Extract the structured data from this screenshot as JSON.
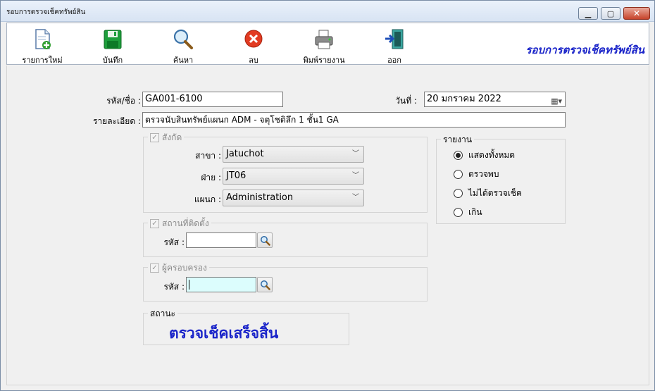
{
  "window": {
    "title": "รอบการตรวจเช็คทรัพย์สิน"
  },
  "toolbar": {
    "buttons": [
      {
        "label": "รายการใหม่",
        "icon": "new-document-icon"
      },
      {
        "label": "บันทึก",
        "icon": "save-disk-icon"
      },
      {
        "label": "ค้นหา",
        "icon": "magnifier-icon"
      },
      {
        "label": "ลบ",
        "icon": "delete-x-icon"
      },
      {
        "label": "พิมพ์รายงาน",
        "icon": "printer-icon"
      },
      {
        "label": "ออก",
        "icon": "exit-door-icon"
      }
    ],
    "heading": "รอบการตรวจเช็คทรัพย์สิน"
  },
  "form": {
    "code_label": "รหัส/ชื่อ :",
    "code_value": "GA001-6100",
    "date_label": "วันที่ :",
    "date_value": "20  มกราคม  2022",
    "detail_label": "รายละเอียด :",
    "detail_value": "ตรวจนับสินทรัพย์แผนก ADM - จตุโชติลึก 1 ชั้น1 GA"
  },
  "affiliation": {
    "legend": "สังกัด",
    "branch_label": "สาขา :",
    "branch_value": "Jatuchot",
    "department_label": "ฝ่าย :",
    "department_value": "JT06",
    "section_label": "แผนก :",
    "section_value": "Administration"
  },
  "location": {
    "legend": "สถานที่ติดตั้ง",
    "code_label": "รหัส :",
    "code_value": ""
  },
  "custodian": {
    "legend": "ผู้ครอบครอง",
    "code_label": "รหัส :",
    "code_value": ""
  },
  "report": {
    "legend": "รายงาน",
    "options": [
      {
        "label": "แสดงทั้งหมด",
        "selected": true
      },
      {
        "label": "ตรวจพบ",
        "selected": false
      },
      {
        "label": "ไม่ได้ตรวจเช็ค",
        "selected": false
      },
      {
        "label": "เกิน",
        "selected": false
      }
    ]
  },
  "status": {
    "legend": "สถานะ",
    "value": "ตรวจเช็คเสร็จสิ้น"
  },
  "colors": {
    "accent_blue": "#1a24c9",
    "field_highlight": "#dcfdfd"
  }
}
